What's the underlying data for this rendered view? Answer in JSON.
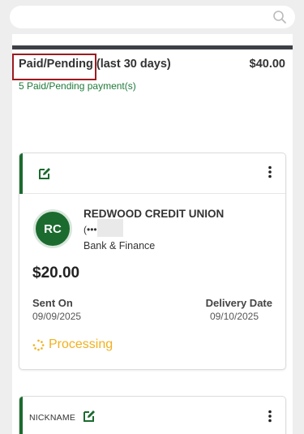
{
  "search": {
    "icon": "search-icon"
  },
  "summary": {
    "status_label": "Paid/Pending",
    "range_label": "(last 30 days)",
    "total": "$40.00",
    "count_text": "5 Paid/Pending payment(s)"
  },
  "payment_card": {
    "edit_icon": "edit-icon",
    "menu_icon": "kebab-menu-icon",
    "payee_initials": "RC",
    "payee_name": "REDWOOD CREDIT UNION",
    "account_prefix": "(•••",
    "category": "Bank & Finance",
    "amount": "$20.00",
    "sent_on_label": "Sent On",
    "sent_on_value": "09/09/2025",
    "delivery_label": "Delivery Date",
    "delivery_value": "09/10/2025",
    "status": "Processing",
    "status_icon": "spinner-icon"
  },
  "next_card": {
    "nickname_label": "NICKNAME",
    "edit_icon": "edit-icon",
    "menu_icon": "kebab-menu-icon"
  },
  "colors": {
    "brand_green": "#1b6b2e",
    "processing": "#f2b01e",
    "highlight": "#9c1b1f",
    "count_green": "#1f7a3a"
  }
}
